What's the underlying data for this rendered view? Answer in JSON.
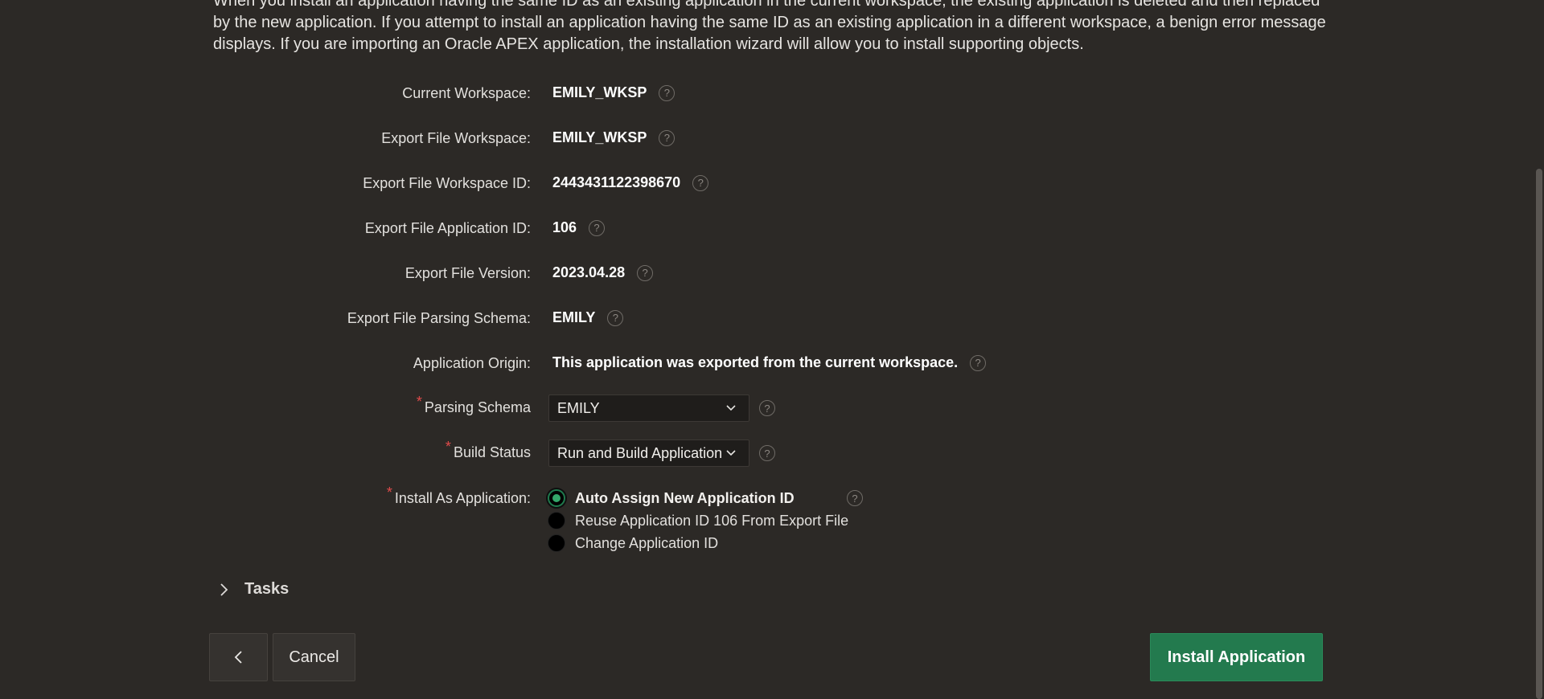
{
  "intro_text": "When you install an application having the same ID as an existing application in the current workspace, the existing application is deleted and then replaced by the new application. If you attempt to install an application having the same ID as an existing application in a different workspace, a benign error message displays. If you are importing an Oracle APEX application, the installation wizard will allow you to install supporting objects.",
  "fields": {
    "current_workspace": {
      "label": "Current Workspace:",
      "value": "EMILY_WKSP"
    },
    "export_file_workspace": {
      "label": "Export File Workspace:",
      "value": "EMILY_WKSP"
    },
    "export_file_workspace_id": {
      "label": "Export File Workspace ID:",
      "value": "2443431122398670"
    },
    "export_file_application_id": {
      "label": "Export File Application ID:",
      "value": "106"
    },
    "export_file_version": {
      "label": "Export File Version:",
      "value": "2023.04.28"
    },
    "export_file_parsing_schema": {
      "label": "Export File Parsing Schema:",
      "value": "EMILY"
    },
    "application_origin": {
      "label": "Application Origin:",
      "value": "This application was exported from the current workspace."
    }
  },
  "parsing_schema": {
    "label": "Parsing Schema",
    "value": "EMILY"
  },
  "build_status": {
    "label": "Build Status",
    "value": "Run and Build Application"
  },
  "install_as": {
    "label": "Install As Application:",
    "options": [
      {
        "label": "Auto Assign New Application ID",
        "selected": true
      },
      {
        "label": "Reuse Application ID 106 From Export File",
        "selected": false
      },
      {
        "label": "Change Application ID",
        "selected": false
      }
    ]
  },
  "required_marker": "*",
  "help_glyph": "?",
  "tasks_label": "Tasks",
  "buttons": {
    "cancel": "Cancel",
    "install": "Install Application"
  },
  "colors": {
    "background": "#2c2926",
    "primary_button": "#237a4e",
    "required": "#e24b4b"
  }
}
